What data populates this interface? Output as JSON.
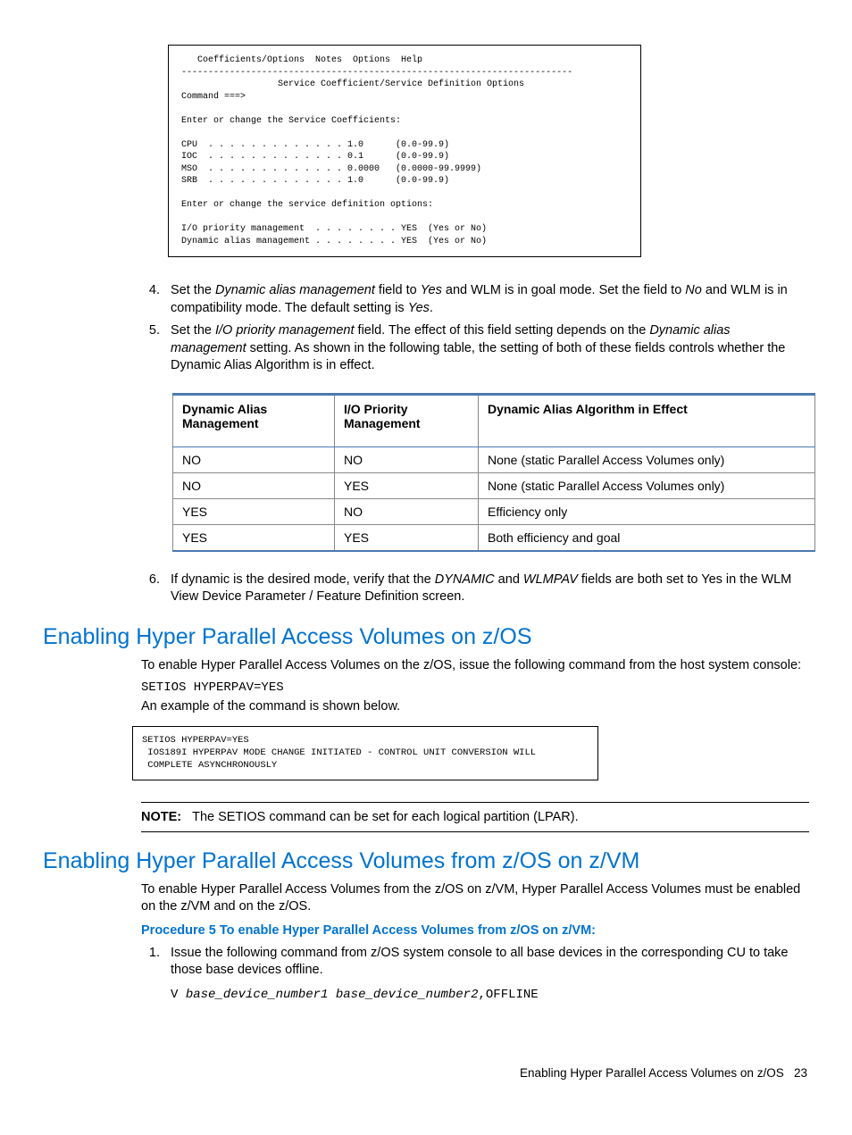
{
  "screen1": {
    "menu": "   Coefficients/Options  Notes  Options  Help",
    "rule": "-------------------------------------------------------------------------",
    "title": "                  Service Coefficient/Service Definition Options",
    "cmd": "Command ===>",
    "blank": "",
    "prompt1": "Enter or change the Service Coefficients:",
    "row_cpu": "CPU  . . . . . . . . . . . . . 1.0      (0.0-99.9)",
    "row_ioc": "IOC  . . . . . . . . . . . . . 0.1      (0.0-99.9)",
    "row_mso": "MSO  . . . . . . . . . . . . . 0.0000   (0.0000-99.9999)",
    "row_srb": "SRB  . . . . . . . . . . . . . 1.0      (0.0-99.9)",
    "prompt2": "Enter or change the service definition options:",
    "row_iop": "I/O priority management  . . . . . . . . YES  (Yes or No)",
    "row_dam": "Dynamic alias management . . . . . . . . YES  (Yes or No)"
  },
  "steps_a": {
    "s4_a": "Set the ",
    "s4_em1": "Dynamic alias management",
    "s4_b": " field to ",
    "s4_em2": "Yes",
    "s4_c": " and WLM is in goal mode. Set the field to ",
    "s4_em3": "No",
    "s4_d": " and WLM is in compatibility mode. The default setting is ",
    "s4_em4": "Yes",
    "s4_e": ".",
    "s5_a": "Set the ",
    "s5_em1": "I/O priority management",
    "s5_b": " field. The effect of this field setting depends on the ",
    "s5_em2": "Dynamic alias management",
    "s5_c": " setting. As shown in the following table, the setting of both of these fields controls whether the Dynamic Alias Algorithm is in effect."
  },
  "table": {
    "h1": "Dynamic Alias Management",
    "h2": "I/O Priority Management",
    "h3": "Dynamic Alias Algorithm in Effect",
    "rows": [
      [
        "NO",
        "NO",
        "None (static Parallel Access Volumes only)"
      ],
      [
        "NO",
        "YES",
        "None (static Parallel Access Volumes only)"
      ],
      [
        "YES",
        "NO",
        "Efficiency only"
      ],
      [
        "YES",
        "YES",
        "Both efficiency and goal"
      ]
    ]
  },
  "steps_b": {
    "s6_a": "If dynamic is the desired mode, verify that the ",
    "s6_em1": "DYNAMIC",
    "s6_b": " and ",
    "s6_em2": "WLMPAV",
    "s6_c": " fields are both set to Yes in the WLM View Device Parameter / Feature Definition screen."
  },
  "sec1": {
    "heading": "Enabling Hyper Parallel Access Volumes on z/OS",
    "p1": "To enable Hyper Parallel Access Volumes on the z/OS, issue the following command from the host system console:",
    "cmd": "SETIOS HYPERPAV=YES",
    "p2": "An example of the command is shown below."
  },
  "screen2": {
    "l1": "SETIOS HYPERPAV=YES",
    "l2": " IOS189I HYPERPAV MODE CHANGE INITIATED - CONTROL UNIT CONVERSION WILL",
    "l3": " COMPLETE ASYNCHRONOUSLY"
  },
  "note": {
    "label": "NOTE:",
    "text": "The SETIOS command can be set for each logical partition (LPAR)."
  },
  "sec2": {
    "heading": "Enabling Hyper Parallel Access Volumes from z/OS on z/VM",
    "p1": "To enable Hyper Parallel Access Volumes from the z/OS on z/VM, Hyper Parallel Access Volumes must be enabled on the z/VM and on the z/OS.",
    "proc": "Procedure 5 To enable Hyper Parallel Access Volumes from z/OS on z/VM:",
    "s1": "Issue the following command from z/OS system console to all base devices in the corresponding CU to take those base devices offline.",
    "cmd_a": "V ",
    "cmd_v1": "base_device_number1",
    "cmd_sp": " ",
    "cmd_v2": "base_device_number2",
    "cmd_b": ",OFFLINE"
  },
  "footer": {
    "text": "Enabling Hyper Parallel Access Volumes on z/OS",
    "page": "23"
  }
}
